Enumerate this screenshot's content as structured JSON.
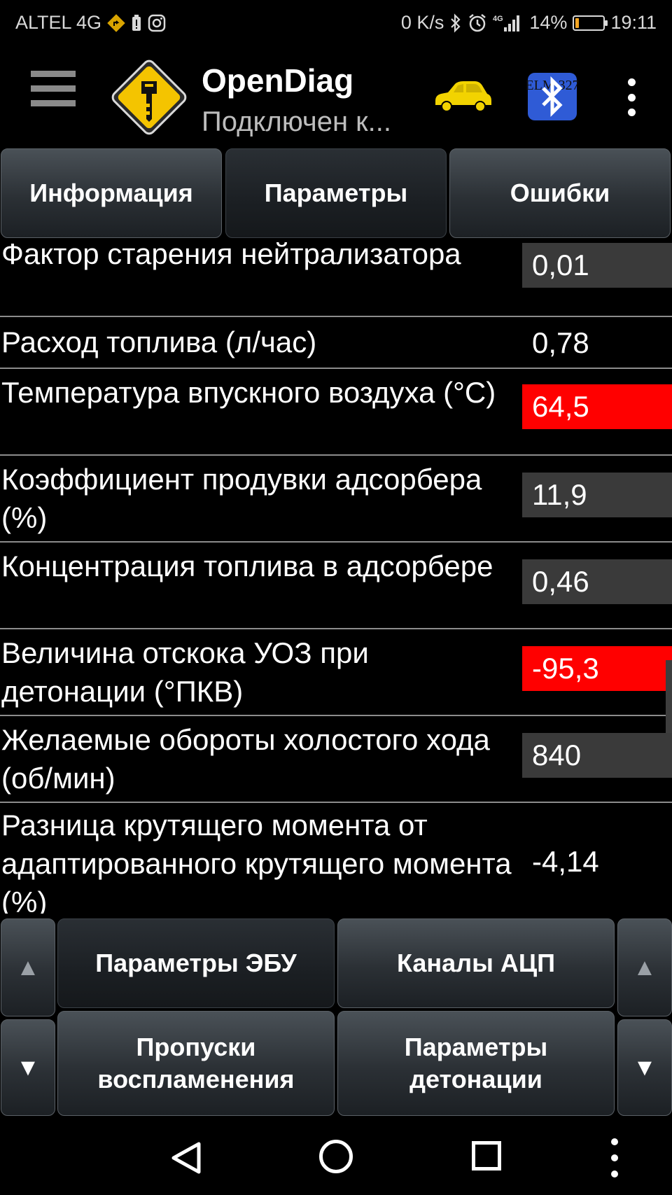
{
  "status_bar": {
    "carrier": "ALTEL 4G",
    "speed": "0 K/s",
    "network": "4G",
    "battery_percent": "14%",
    "battery_level": 0.14,
    "time": "19:11"
  },
  "header": {
    "title": "OpenDiag",
    "subtitle": "Подключен к...",
    "bt_badge": "ELM 327"
  },
  "tabs": [
    {
      "label": "Информация",
      "active": false
    },
    {
      "label": "Параметры",
      "active": true
    },
    {
      "label": "Ошибки",
      "active": false
    }
  ],
  "parameters": [
    {
      "label": "Фактор старения нейтрализатора",
      "value": "0,01",
      "state": "normal"
    },
    {
      "label": "Расход топлива (л/час)",
      "value": "0,78",
      "state": "none"
    },
    {
      "label": "Температура впускного воздуха (°C)",
      "value": "64,5",
      "state": "alert"
    },
    {
      "label": "Коэффициент продувки адсорбера (%)",
      "value": "11,9",
      "state": "normal"
    },
    {
      "label": "Концентрация топлива в адсорбере",
      "value": "0,46",
      "state": "normal"
    },
    {
      "label": "Величина отскока УОЗ при детонации (°ПКВ)",
      "value": "-95,3",
      "state": "alert"
    },
    {
      "label": "Желаемые обороты холостого хода (об/мин)",
      "value": "840",
      "state": "normal"
    },
    {
      "label": "Разница крутящего момента от адаптированного крутящего момента (%)",
      "value": "-4,14",
      "state": "none"
    }
  ],
  "bottom_buttons": {
    "up_arrow": "▲",
    "down_arrow": "▼",
    "ecu_params": "Параметры ЭБУ",
    "adc_channels": "Каналы АЦП",
    "misfires_line1": "Пропуски",
    "misfires_line2": "воспламенения",
    "knock_line1": "Параметры",
    "knock_line2": "детонации"
  },
  "colors": {
    "alert": "#ff0000",
    "value_bg": "#3a3a3a",
    "battery_low": "#f5a623",
    "car": "#f2d300",
    "bluetooth": "#2f5bd6"
  }
}
